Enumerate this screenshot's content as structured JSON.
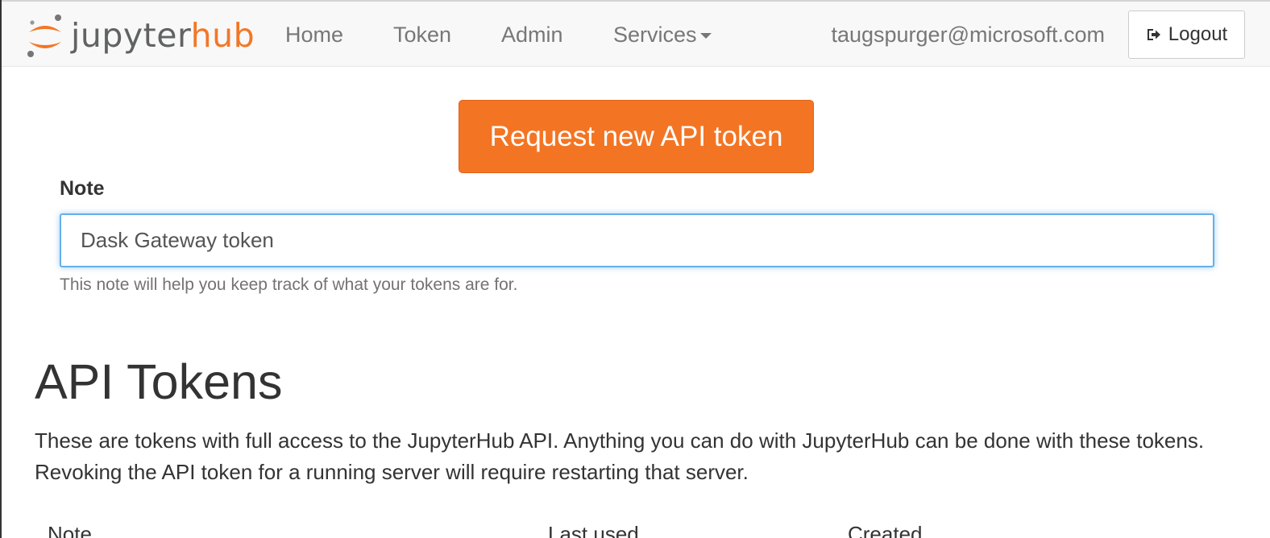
{
  "navbar": {
    "brand": {
      "prefix": "jupyter",
      "suffix": "hub"
    },
    "links": [
      {
        "label": "Home"
      },
      {
        "label": "Token"
      },
      {
        "label": "Admin"
      },
      {
        "label": "Services"
      }
    ],
    "user_email": "taugspurger@microsoft.com",
    "logout_label": "Logout"
  },
  "token_form": {
    "request_button_label": "Request new API token",
    "note_label": "Note",
    "note_value": "Dask Gateway token",
    "help_text": "This note will help you keep track of what your tokens are for."
  },
  "api_tokens": {
    "title": "API Tokens",
    "description": "These are tokens with full access to the JupyterHub API. Anything you can do with JupyterHub can be done with these tokens. Revoking the API token for a running server will require restarting that server.",
    "columns": [
      "Note",
      "Last used",
      "Created"
    ]
  },
  "colors": {
    "brand_orange": "#f37726",
    "logo_gray": "#616262",
    "focus_blue": "#66afe9"
  },
  "icons": {
    "logout": "sign-out-icon",
    "logo": "jupyter-logo-icon",
    "services_caret": "caret-down-icon"
  }
}
